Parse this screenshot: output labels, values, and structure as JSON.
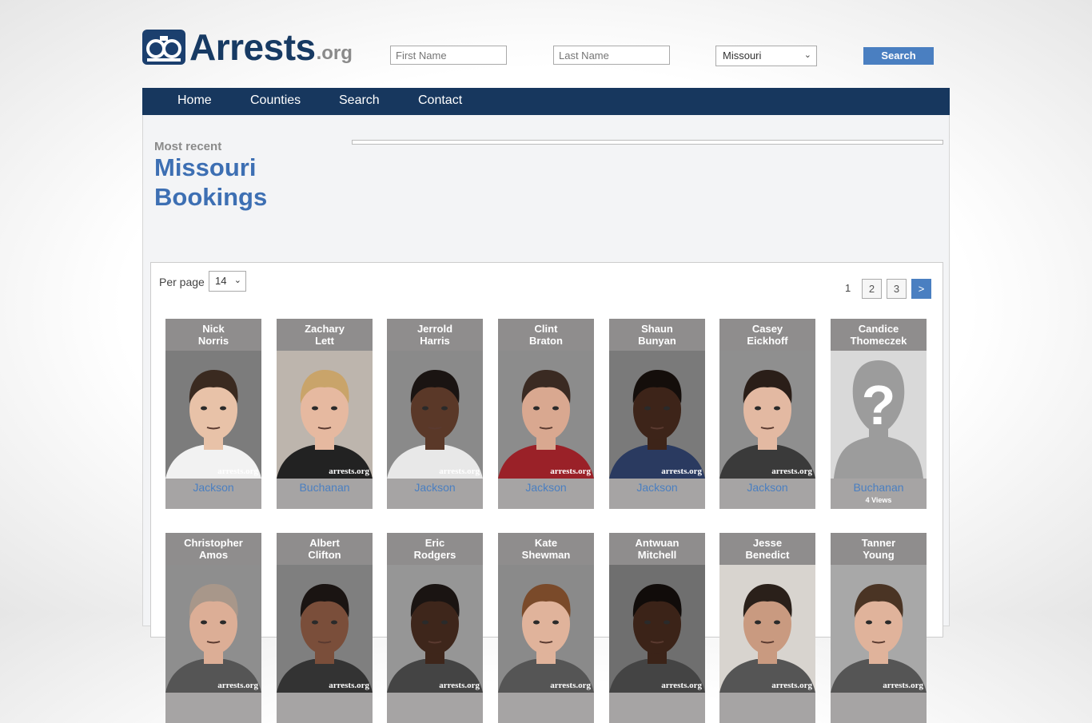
{
  "header": {
    "logo_text": "Arrests",
    "logo_suffix": ".org",
    "first_name_placeholder": "First Name",
    "last_name_placeholder": "Last Name",
    "state_selected": "Missouri",
    "search_label": "Search"
  },
  "nav": {
    "items": [
      {
        "label": "Home"
      },
      {
        "label": "Counties"
      },
      {
        "label": "Search"
      },
      {
        "label": "Contact"
      }
    ]
  },
  "main": {
    "subtitle": "Most recent",
    "title_line1": "Missouri",
    "title_line2": "Bookings"
  },
  "listing": {
    "per_page_label": "Per page",
    "per_page_value": "14",
    "pagination": {
      "current": "1",
      "pages": [
        "2",
        "3"
      ],
      "next": ">"
    },
    "watermark": "arrests.org",
    "cards": [
      {
        "first": "Nick",
        "last": "Norris",
        "county": "Jackson",
        "views": "",
        "skin": "#e8c2a8",
        "hair": "#3a2a20",
        "shirt": "#f2f2f2",
        "bg": "#7c7c7c",
        "placeholder": false
      },
      {
        "first": "Zachary",
        "last": "Lett",
        "county": "Buchanan",
        "views": "",
        "skin": "#e6b9a0",
        "hair": "#c9a46a",
        "shirt": "#222222",
        "bg": "#bdb5ad",
        "placeholder": false
      },
      {
        "first": "Jerrold",
        "last": "Harris",
        "county": "Jackson",
        "views": "",
        "skin": "#5a3828",
        "hair": "#1a1412",
        "shirt": "#e8e8e8",
        "bg": "#8a8a8a",
        "placeholder": false
      },
      {
        "first": "Clint",
        "last": "Braton",
        "county": "Jackson",
        "views": "",
        "skin": "#d9a890",
        "hair": "#3a2a22",
        "shirt": "#9a2128",
        "bg": "#8c8c8c",
        "placeholder": false
      },
      {
        "first": "Shaun",
        "last": "Bunyan",
        "county": "Jackson",
        "views": "",
        "skin": "#3d2419",
        "hair": "#140e0b",
        "shirt": "#2a3a60",
        "bg": "#7a7a7a",
        "placeholder": false
      },
      {
        "first": "Casey",
        "last": "Eickhoff",
        "county": "Jackson",
        "views": "",
        "skin": "#e3b9a2",
        "hair": "#2a1e18",
        "shirt": "#3a3a3a",
        "bg": "#8f8f8f",
        "placeholder": false
      },
      {
        "first": "Candice",
        "last": "Thomeczek",
        "county": "Buchanan",
        "views": "4 Views",
        "skin": "",
        "hair": "",
        "shirt": "",
        "bg": "#d9d9d9",
        "placeholder": true
      },
      {
        "first": "Christopher",
        "last": "Amos",
        "county": "",
        "views": "",
        "skin": "#dcae96",
        "hair": "#a8978a",
        "shirt": "#555555",
        "bg": "#8e8e8e",
        "placeholder": false
      },
      {
        "first": "Albert",
        "last": "Clifton",
        "county": "",
        "views": "",
        "skin": "#7a4e3a",
        "hair": "#1a1412",
        "shirt": "#333333",
        "bg": "#7f7f7f",
        "placeholder": false
      },
      {
        "first": "Eric",
        "last": "Rodgers",
        "county": "",
        "views": "",
        "skin": "#3e261b",
        "hair": "#1a1412",
        "shirt": "#444444",
        "bg": "#969696",
        "placeholder": false
      },
      {
        "first": "Kate",
        "last": "Shewman",
        "county": "",
        "views": "",
        "skin": "#e0b39b",
        "hair": "#7a4a2a",
        "shirt": "#555555",
        "bg": "#8a8a8a",
        "placeholder": false
      },
      {
        "first": "Antwuan",
        "last": "Mitchell",
        "county": "",
        "views": "",
        "skin": "#3b2318",
        "hair": "#110c0a",
        "shirt": "#444444",
        "bg": "#6f6f6f",
        "placeholder": false
      },
      {
        "first": "Jesse",
        "last": "Benedict",
        "county": "",
        "views": "",
        "skin": "#c99a80",
        "hair": "#2a201a",
        "shirt": "#555555",
        "bg": "#d8d4cf",
        "placeholder": false
      },
      {
        "first": "Tanner",
        "last": "Young",
        "county": "",
        "views": "",
        "skin": "#e0b39b",
        "hair": "#4a3424",
        "shirt": "#555555",
        "bg": "#a8a8a8",
        "placeholder": false
      }
    ]
  }
}
